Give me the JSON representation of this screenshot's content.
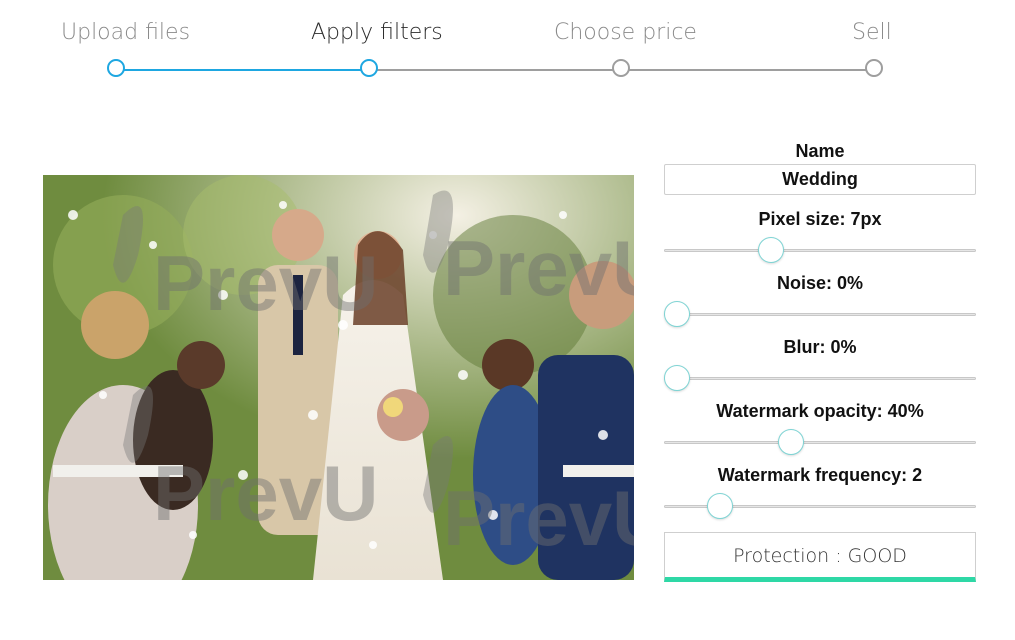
{
  "stepper": {
    "steps": [
      {
        "label": "Upload files",
        "state": "done"
      },
      {
        "label": "Apply filters",
        "state": "active"
      },
      {
        "label": "Choose price",
        "state": "pending"
      },
      {
        "label": "Sell",
        "state": "pending"
      }
    ],
    "colors": {
      "done": "#1ea7e1",
      "pending": "#9e9e9e"
    }
  },
  "preview": {
    "watermark_text": "PrevU"
  },
  "controls": {
    "name": {
      "label": "Name",
      "value": "Wedding"
    },
    "pixel_size": {
      "label": "Pixel size: 7px",
      "value": 7,
      "level": 0.33
    },
    "noise": {
      "label": "Noise: 0%",
      "value": 0,
      "level": 0.0
    },
    "blur": {
      "label": "Blur: 0%",
      "value": 0,
      "level": 0.0
    },
    "watermark_opacity": {
      "label": "Watermark opacity: 40%",
      "value": 40,
      "level": 0.4
    },
    "watermark_frequency": {
      "label": "Watermark frequency: 2",
      "value": 2,
      "level": 0.15
    },
    "thumb_color": "#7fd4d4"
  },
  "protection": {
    "label": "Protection : GOOD",
    "color": "#2ed8a6"
  }
}
